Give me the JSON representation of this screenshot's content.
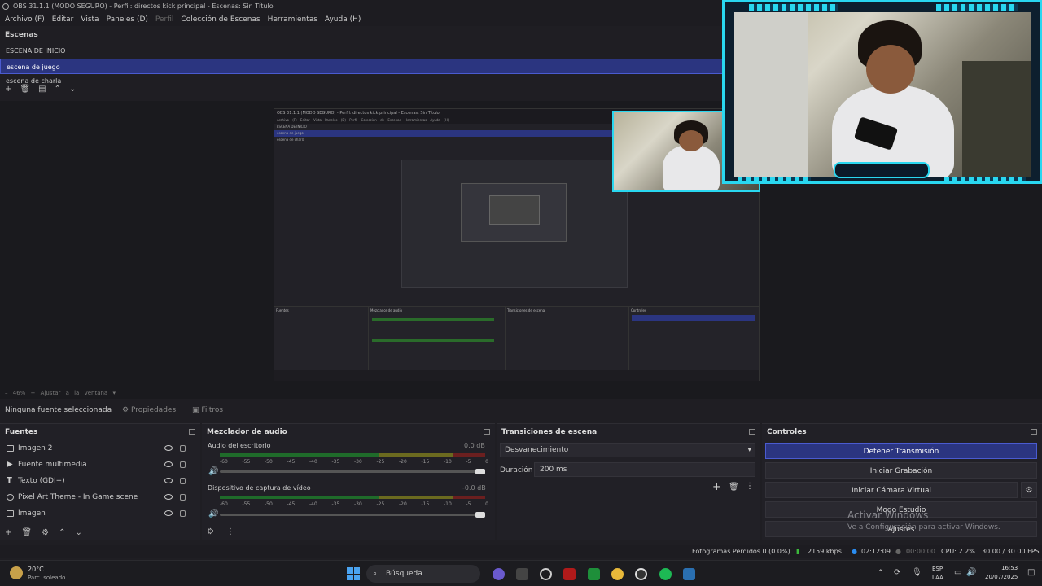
{
  "window": {
    "title": "OBS 31.1.1 (MODO SEGURO) - Perfil: directos kick principal - Escenas: Sin Título"
  },
  "menu": [
    "Archivo (F)",
    "Editar",
    "Vista",
    "Paneles (D)",
    "Perfil",
    "Colección de Escenas",
    "Herramientas",
    "Ayuda (H)"
  ],
  "scenes": {
    "title": "Escenas",
    "items": [
      "ESCENA DE INICIO",
      "escena de juego",
      "escena de charla"
    ],
    "selected": "escena de juego"
  },
  "nested_preview": {
    "title": "OBS 31.1.1 (MODO SEGURO) - Perfil: directos kick principal - Escenas: Sin Título",
    "menu": "Archivo (F) Editar Vista Paneles (D) Perfil Colección de Escenas Herramientas Ayuda (H)"
  },
  "preview_controls": {
    "zoom": "46%",
    "fit": "Ajustar a la ventana"
  },
  "source_bar": {
    "none_selected": "Ninguna fuente seleccionada",
    "properties": "Propiedades",
    "filters": "Filtros"
  },
  "sources": {
    "title": "Fuentes",
    "items": [
      {
        "name": "Imagen 2",
        "icon": "image-icon"
      },
      {
        "name": "Fuente multimedia",
        "icon": "play-icon"
      },
      {
        "name": "Texto (GDI+)",
        "icon": "text-icon"
      },
      {
        "name": "Pixel Art Theme - In Game scene",
        "icon": "globe-icon"
      },
      {
        "name": "Imagen",
        "icon": "image-icon"
      }
    ]
  },
  "audio_mixer": {
    "title": "Mezclador de audio",
    "scale": [
      "-60",
      "-55",
      "-50",
      "-45",
      "-40",
      "-35",
      "-30",
      "-25",
      "-20",
      "-15",
      "-10",
      "-5",
      "0"
    ],
    "channels": [
      {
        "name": "Audio del escritorio",
        "db": "0.0 dB",
        "volume": 1.0
      },
      {
        "name": "Dispositivo de captura de vídeo",
        "db": "-0.0 dB",
        "volume": 1.0
      }
    ]
  },
  "transitions": {
    "title": "Transiciones de escena",
    "selected": "Desvanecimiento",
    "duration_label": "Duración",
    "duration_value": "200 ms"
  },
  "controls": {
    "title": "Controles",
    "buttons": [
      "Detener Transmisión",
      "Iniciar Grabación",
      "Iniciar Cámara Virtual",
      "Modo Estudio",
      "Ajustes"
    ]
  },
  "watermark": {
    "line1": "Activar Windows",
    "line2": "Ve a Configuración para activar Windows."
  },
  "status": {
    "dropped": "Fotogramas Perdidos 0 (0.0%)",
    "bitrate": "2159 kbps",
    "live_time": "02:12:09",
    "rec_time": "00:00:00",
    "cpu": "CPU: 2.2%",
    "fps": "30.00 / 30.00 FPS"
  },
  "taskbar": {
    "weather_temp": "20°C",
    "weather_desc": "Parc. soleado",
    "search": "Búsqueda",
    "lang1": "ESP",
    "lang2": "LAA",
    "time": "16:53",
    "date": "20/07/2025"
  },
  "colors": {
    "accent": "#2b3580",
    "frame": "#29d7f0"
  }
}
